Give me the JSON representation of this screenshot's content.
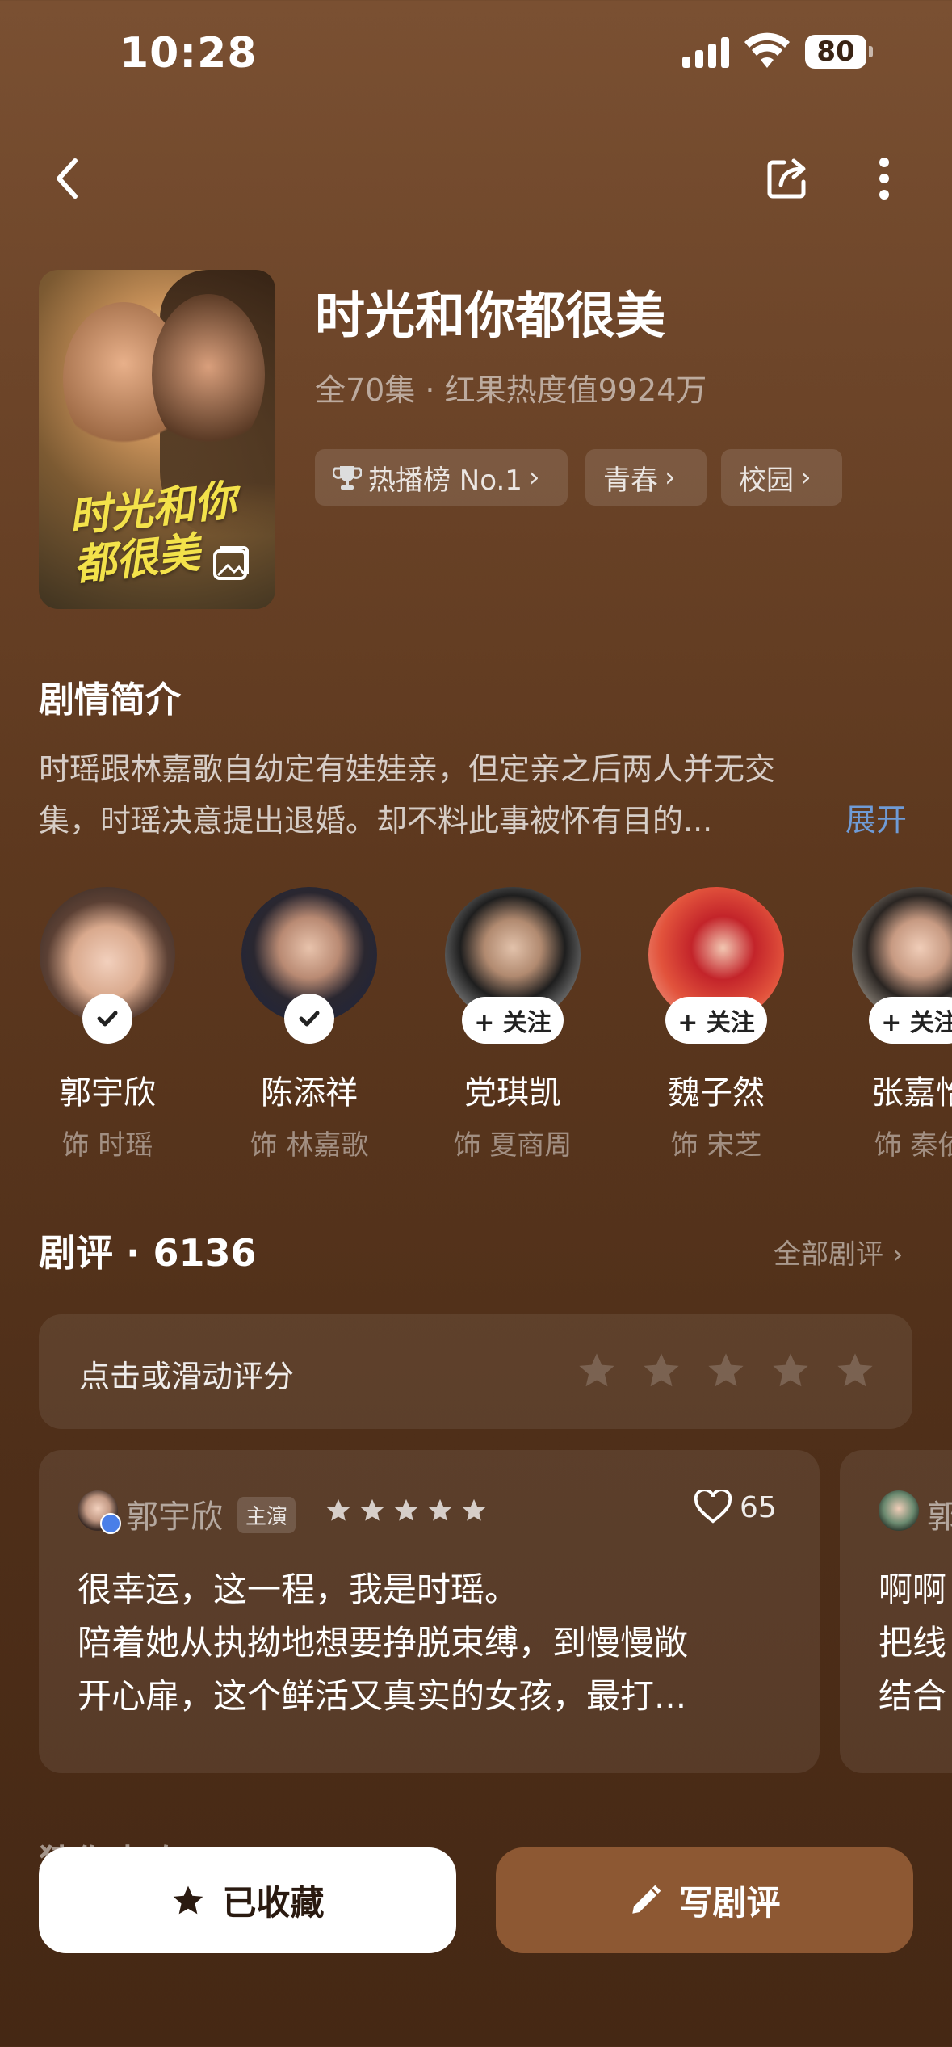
{
  "status_bar": {
    "time": "10:28",
    "battery": "80"
  },
  "nav": {
    "back_icon": "chevron-left-icon",
    "share_icon": "share-icon",
    "more_icon": "more-vertical-icon"
  },
  "show": {
    "title": "时光和你都很美",
    "meta": "全70集 · 红果热度值9924万",
    "poster_title": "时光和你都很美",
    "tags": [
      {
        "label": "热播榜 No.1",
        "icon": "trophy-icon"
      },
      {
        "label": "青春"
      },
      {
        "label": "校园"
      }
    ]
  },
  "synopsis": {
    "title": "剧情简介",
    "text_line1": "时瑶跟林嘉歌自幼定有娃娃亲，但定亲之后两人并无交",
    "text_line2": "集，时瑶决意提出退婚。却不料此事被怀有目的...",
    "expand": "展开"
  },
  "cast": [
    {
      "name": "郭宇欣",
      "role": "饰 时瑶",
      "followed": true
    },
    {
      "name": "陈添祥",
      "role": "饰 林嘉歌",
      "followed": true
    },
    {
      "name": "党琪凯",
      "role": "饰 夏商周",
      "followed": false,
      "follow_label": "+ 关注"
    },
    {
      "name": "魏子然",
      "role": "饰 宋芝",
      "followed": false,
      "follow_label": "+ 关注"
    },
    {
      "name": "张嘉怡",
      "role": "饰 秦依",
      "followed": false,
      "follow_label": "+ 关注"
    }
  ],
  "reviews": {
    "heading": "剧评 · 6136",
    "all_link": "全部剧评",
    "rate_prompt": "点击或滑动评分",
    "cards": [
      {
        "user": "郭宇欣",
        "badge": "主演",
        "stars": 5,
        "likes": "65",
        "line1": "很幸运，这一程，我是时瑶。",
        "line2": "陪着她从执拗地想要挣脱束缚，到慢慢敞",
        "line3": "开心扉，这个鲜活又真实的女孩，最打..."
      },
      {
        "user": "郭",
        "line1": "啊啊",
        "line2": "把线",
        "line3": "结合"
      }
    ]
  },
  "peek_section": "猜你喜欢",
  "actions": {
    "favorite": "已收藏",
    "write_review": "写剧评"
  },
  "colors": {
    "bg_top": "#7a5032",
    "bg_bottom": "#452814",
    "accent_button": "#8d5833",
    "link": "#6f9bd6"
  }
}
